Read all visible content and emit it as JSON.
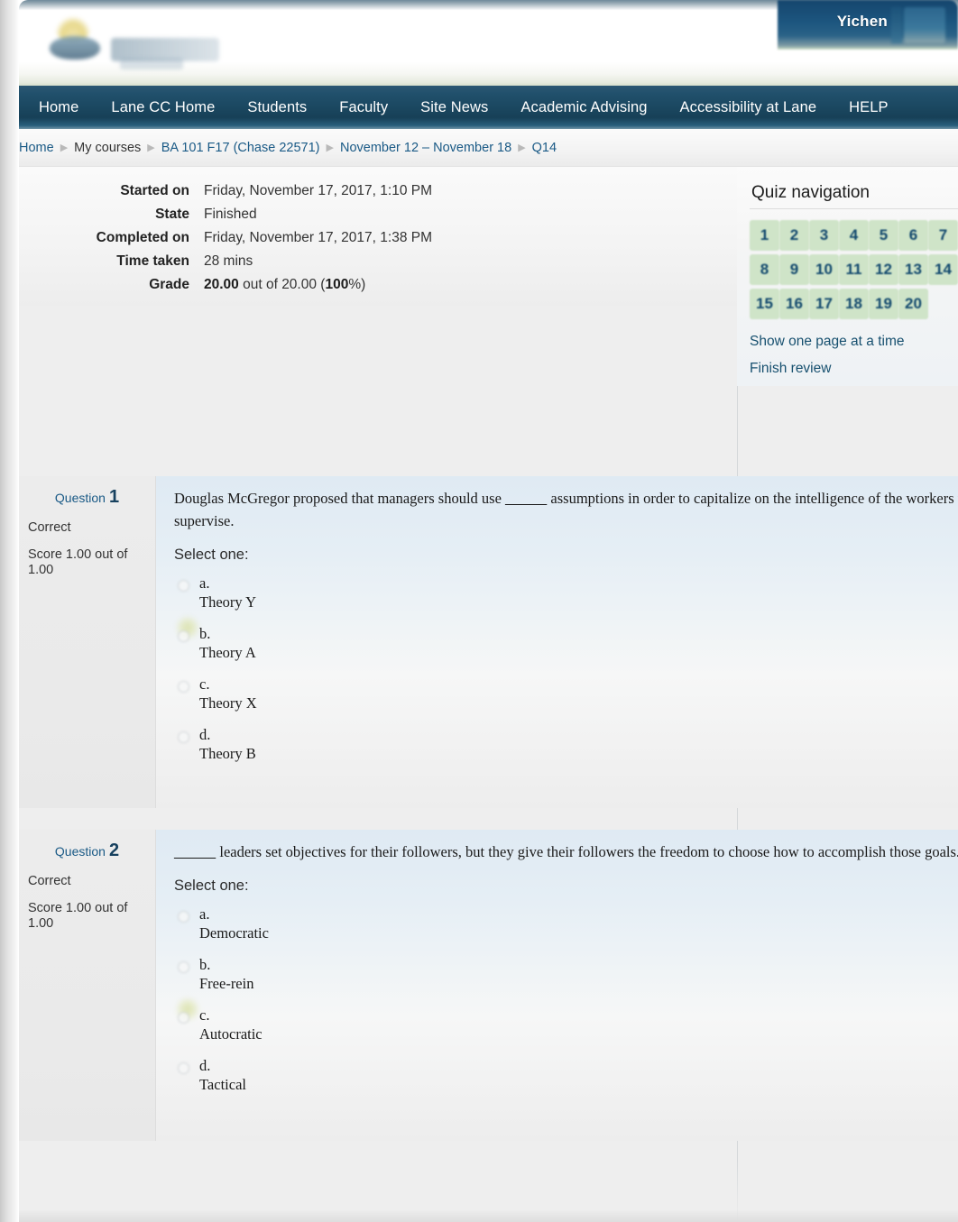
{
  "header": {
    "user_name": "Yichen",
    "logo_alt": "lane-community-college-logo"
  },
  "nav": {
    "items": [
      {
        "label": "Home"
      },
      {
        "label": "Lane CC Home"
      },
      {
        "label": "Students"
      },
      {
        "label": "Faculty"
      },
      {
        "label": "Site News"
      },
      {
        "label": "Academic Advising"
      },
      {
        "label": "Accessibility at Lane"
      },
      {
        "label": "HELP"
      }
    ]
  },
  "breadcrumb": {
    "separator": "▶",
    "items": [
      {
        "label": "Home",
        "link": true
      },
      {
        "label": "My courses",
        "link": false
      },
      {
        "label": "BA 101 F17 (Chase 22571)",
        "link": true
      },
      {
        "label": "November 12 – November 18",
        "link": true
      },
      {
        "label": "Q14",
        "link": true
      }
    ]
  },
  "summary": {
    "rows": [
      {
        "key": "Started on",
        "value": "Friday, November 17, 2017, 1:10 PM"
      },
      {
        "key": "State",
        "value": "Finished"
      },
      {
        "key": "Completed on",
        "value": "Friday, November 17, 2017, 1:38 PM"
      },
      {
        "key": "Time taken",
        "value": "28 mins"
      }
    ],
    "grade": {
      "key": "Grade",
      "score": "20.00",
      "mid": " out of 20.00 (",
      "percent": "100",
      "tail": "%)"
    }
  },
  "quiz_navigation": {
    "title": "Quiz navigation",
    "buttons": [
      "1",
      "2",
      "3",
      "4",
      "5",
      "6",
      "7",
      "8",
      "9",
      "10",
      "11",
      "12",
      "13",
      "14",
      "15",
      "16",
      "17",
      "18",
      "19",
      "20"
    ],
    "show_one_page_label": "Show one page at a time",
    "finish_review_label": "Finish review",
    "answered_color": "#cfe4c8",
    "number_color": "#11486d"
  },
  "questions": [
    {
      "number_label": "Question",
      "number": "1",
      "state": "Correct",
      "score": "Score 1.00 out of 1.00",
      "text_before_blank": "Douglas McGregor proposed that managers should use ",
      "blank": "_____",
      "text_after_blank": " assumptions in order to capitalize on the intelligence of the workers they",
      "text_line2": "supervise.",
      "select_label": "Select one:",
      "answers": [
        {
          "letter": "a.",
          "text": "Theory Y",
          "correct_mark": true
        },
        {
          "letter": "b.",
          "text": "Theory A",
          "correct_mark": false
        },
        {
          "letter": "c.",
          "text": "Theory X",
          "correct_mark": false
        },
        {
          "letter": "d.",
          "text": "Theory B",
          "correct_mark": false
        }
      ]
    },
    {
      "number_label": "Question",
      "number": "2",
      "state": "Correct",
      "score": "Score 1.00 out of 1.00",
      "text_before_blank": "",
      "blank": "_____",
      "text_after_blank": " leaders set objectives for their followers, but they give their followers the freedom to choose how to accomplish those goals.",
      "text_line2": "",
      "select_label": "Select one:",
      "answers": [
        {
          "letter": "a.",
          "text": "Democratic",
          "correct_mark": false
        },
        {
          "letter": "b.",
          "text": "Free-rein",
          "correct_mark": true
        },
        {
          "letter": "c.",
          "text": "Autocratic",
          "correct_mark": false
        },
        {
          "letter": "d.",
          "text": "Tactical",
          "correct_mark": false
        }
      ]
    }
  ]
}
